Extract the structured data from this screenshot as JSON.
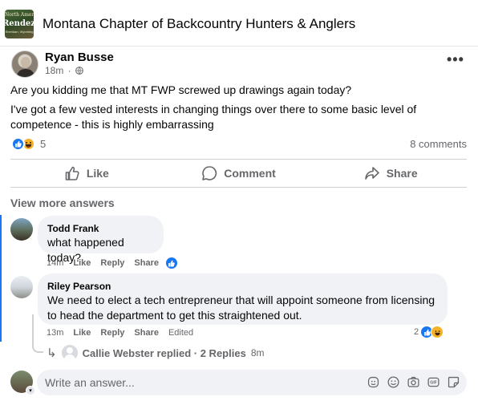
{
  "group": {
    "avatar_top": "North America",
    "avatar_mid": "Rendezvous",
    "avatar_bot": "Sheridan, Wyoming",
    "title": "Montana Chapter of Backcountry Hunters & Anglers"
  },
  "post": {
    "author": "Ryan Busse",
    "time": "18m",
    "paragraph1": "Are you kidding me that MT FWP screwed up drawings again today?",
    "paragraph2": "I've got a few vested interests in changing things over there to some basic level of competence - this is highly embarrassing",
    "reaction_count": "5",
    "comments_count": "8 comments",
    "actions": {
      "like": "Like",
      "comment": "Comment",
      "share": "Share"
    }
  },
  "view_more": "View more answers",
  "comments": [
    {
      "name": "Todd Frank",
      "text": "what happened today?",
      "time": "14m",
      "like": "Like",
      "reply": "Reply",
      "share": "Share"
    },
    {
      "name": "Riley Pearson",
      "text": "We need to elect a tech entrepreneur that will appoint someone from licensing to head the department to get this straightened out.",
      "time": "13m",
      "like": "Like",
      "reply": "Reply",
      "share": "Share",
      "edited": "Edited",
      "reaction_count": "2"
    }
  ],
  "replies_row": {
    "text": "Callie Webster replied · 2 Replies",
    "time": "8m"
  },
  "composer": {
    "placeholder": "Write an answer..."
  },
  "colors": {
    "accent": "#1877f2",
    "haha": "#f7b125",
    "secondary_text": "#65676b",
    "bubble": "#f0f2f5"
  }
}
